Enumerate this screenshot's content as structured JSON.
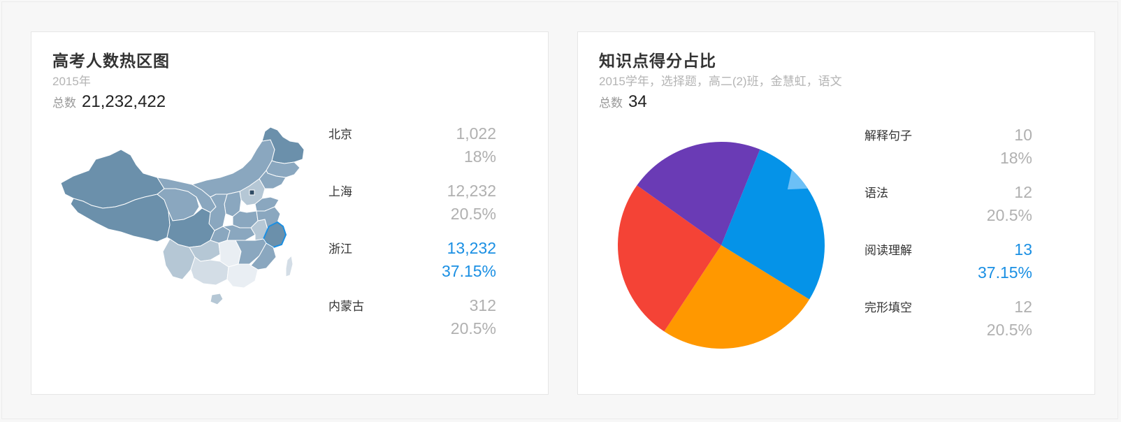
{
  "colors": {
    "active": "#1a8fe3",
    "map_dark": "#6b90ab",
    "map_mid": "#8aa7bf",
    "map_light": "#b5c7d5",
    "map_lighter": "#d3dde6",
    "map_lightest": "#e9eef3",
    "pie_blue": "#0593e8",
    "pie_purple": "#6a3bb5",
    "pie_red": "#f44336",
    "pie_orange": "#ff9800",
    "pie_highlight": "#6cc0f6"
  },
  "left_card": {
    "title": "高考人数热区图",
    "subtitle": "2015年",
    "total_label": "总数",
    "total_value": "21,232,422",
    "legend": [
      {
        "name": "北京",
        "value": "1,022",
        "pct": "18%",
        "active": false
      },
      {
        "name": "上海",
        "value": "12,232",
        "pct": "20.5%",
        "active": false
      },
      {
        "name": "浙江",
        "value": "13,232",
        "pct": "37.15%",
        "active": true
      },
      {
        "name": "内蒙古",
        "value": "312",
        "pct": "20.5%",
        "active": false
      }
    ],
    "map_icon": "china-map"
  },
  "right_card": {
    "title": "知识点得分占比",
    "subtitle": "2015学年，选择题，高二(2)班，金慧虹，语文",
    "total_label": "总数",
    "total_value": "34",
    "legend": [
      {
        "name": "解释句子",
        "value": "10",
        "pct": "18%",
        "active": false
      },
      {
        "name": "语法",
        "value": "12",
        "pct": "20.5%",
        "active": false
      },
      {
        "name": "阅读理解",
        "value": "13",
        "pct": "37.15%",
        "active": true
      },
      {
        "name": "完形填空",
        "value": "12",
        "pct": "20.5%",
        "active": false
      }
    ]
  },
  "chart_data": [
    {
      "type": "map",
      "title": "高考人数热区图",
      "subtitle": "2015年",
      "total": 21232422,
      "regions": [
        {
          "name": "北京",
          "value": 1022,
          "pct": 18
        },
        {
          "name": "上海",
          "value": 12232,
          "pct": 20.5
        },
        {
          "name": "浙江",
          "value": 13232,
          "pct": 37.15,
          "highlighted": true
        },
        {
          "name": "内蒙古",
          "value": 312,
          "pct": 20.5
        }
      ]
    },
    {
      "type": "pie",
      "title": "知识点得分占比",
      "subtitle": "2015学年，选择题，高二(2)班，金慧虹，语文",
      "total": 34,
      "slices": [
        {
          "name": "阅读理解",
          "value": 13,
          "pct": 37.15,
          "color": "#0593e8",
          "highlighted": true
        },
        {
          "name": "完形填空",
          "value": 12,
          "pct": 20.5,
          "color": "#ff9800"
        },
        {
          "name": "语法",
          "value": 12,
          "pct": 20.5,
          "color": "#f44336"
        },
        {
          "name": "解释句子",
          "value": 10,
          "pct": 18,
          "color": "#6a3bb5"
        }
      ]
    }
  ]
}
